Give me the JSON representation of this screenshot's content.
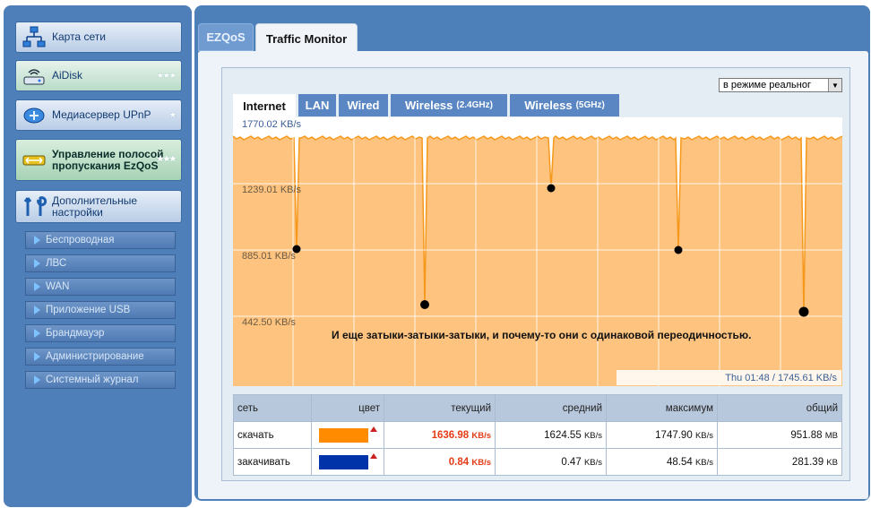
{
  "sidebar": {
    "items": [
      {
        "label": "Карта сети",
        "icon": "network-map-icon"
      },
      {
        "label": "AiDisk",
        "icon": "aidisk-icon"
      },
      {
        "label": "Медиасервер UPnP",
        "icon": "media-server-icon"
      },
      {
        "label": "Управление полосой пропускания EzQoS",
        "icon": "ezqos-icon"
      },
      {
        "label": "Дополнительные настройки",
        "icon": "wrench-icon"
      }
    ],
    "sub_items": [
      {
        "label": "Беспроводная"
      },
      {
        "label": "ЛВС"
      },
      {
        "label": "WAN"
      },
      {
        "label": "Приложение USB"
      },
      {
        "label": "Брандмауэр"
      },
      {
        "label": "Администрирование"
      },
      {
        "label": "Системный журнал"
      }
    ]
  },
  "main": {
    "tabs": [
      {
        "label": "EZQoS"
      },
      {
        "label": "Traffic Monitor"
      }
    ],
    "mode_select": {
      "value": "в режиме реальног"
    },
    "interface_tabs": [
      {
        "label": "Internet",
        "suffix": ""
      },
      {
        "label": "LAN",
        "suffix": ""
      },
      {
        "label": "Wired",
        "suffix": ""
      },
      {
        "label": "Wireless",
        "suffix": "(2.4GHz)"
      },
      {
        "label": "Wireless",
        "suffix": "(5GHz)"
      }
    ],
    "graph": {
      "y_labels": [
        "1770.02 KB/s",
        "1239.01 KB/s",
        "885.01 KB/s",
        "442.50 KB/s"
      ],
      "annotation": "И еще затыки-затыки-затыки, и почему-то они с одинаковой переодичностью.",
      "tooltip": "Thu 01:48 / 1745.61 KB/s",
      "fill_color": "#fec37e",
      "line_color": "#f6981a"
    },
    "stats": {
      "headers": [
        "сеть",
        "цвет",
        "текущий",
        "средний",
        "максимум",
        "общий"
      ],
      "rows": [
        {
          "name": "скачать",
          "color": "#ff8c00",
          "current": "1636.98",
          "current_unit": "KB/s",
          "average": "1624.55",
          "average_unit": "KB/s",
          "max": "1747.90",
          "max_unit": "KB/s",
          "total": "951.88",
          "total_unit": "MB"
        },
        {
          "name": "закачивать",
          "color": "#0033aa",
          "current": "0.84",
          "current_unit": "KB/s",
          "average": "0.47",
          "average_unit": "KB/s",
          "max": "48.54",
          "max_unit": "KB/s",
          "total": "281.39",
          "total_unit": "KB"
        }
      ]
    }
  }
}
